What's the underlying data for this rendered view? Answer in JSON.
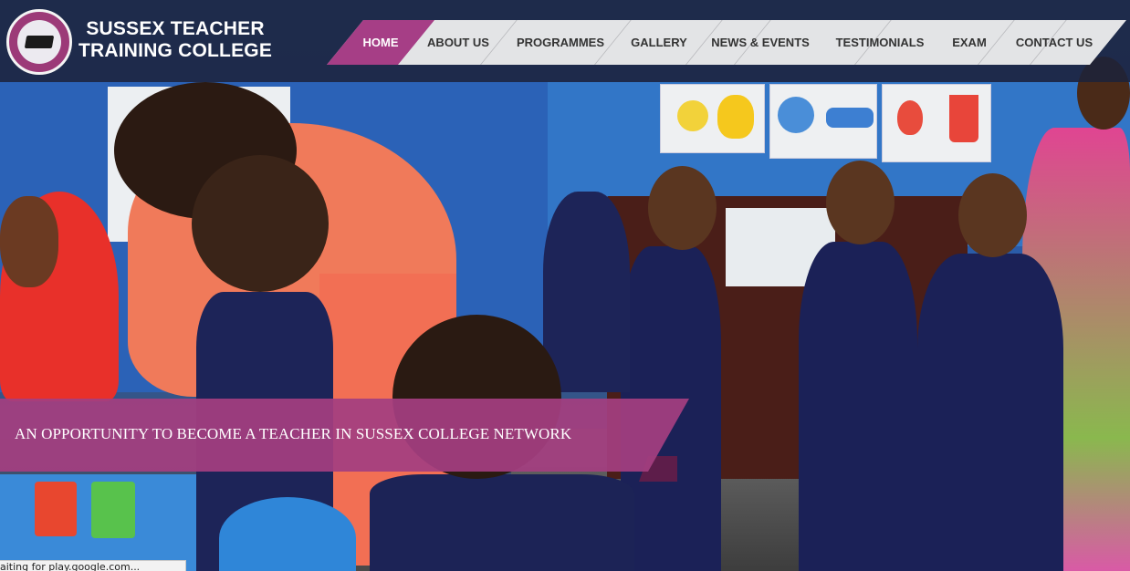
{
  "brand": {
    "line1": "SUSSEX TEACHER",
    "line2": "TRAINING COLLEGE",
    "logo_icon": "graduation-cap-globe-icon",
    "accent_color": "#a63e86"
  },
  "nav": {
    "items": [
      {
        "label": "HOME",
        "active": true
      },
      {
        "label": "ABOUT US",
        "active": false
      },
      {
        "label": "PROGRAMMES",
        "active": false
      },
      {
        "label": "GALLERY",
        "active": false
      },
      {
        "label": "NEWS & EVENTS",
        "active": false
      },
      {
        "label": "TESTIMONIALS",
        "active": false
      },
      {
        "label": "EXAM",
        "active": false
      },
      {
        "label": "CONTACT US",
        "active": false
      }
    ]
  },
  "hero": {
    "banner_text": "AN OPPORTUNITY TO BECOME A TEACHER IN SUSSEX COLLEGE NETWORK"
  },
  "status": {
    "text": "aiting for play.google.com..."
  }
}
